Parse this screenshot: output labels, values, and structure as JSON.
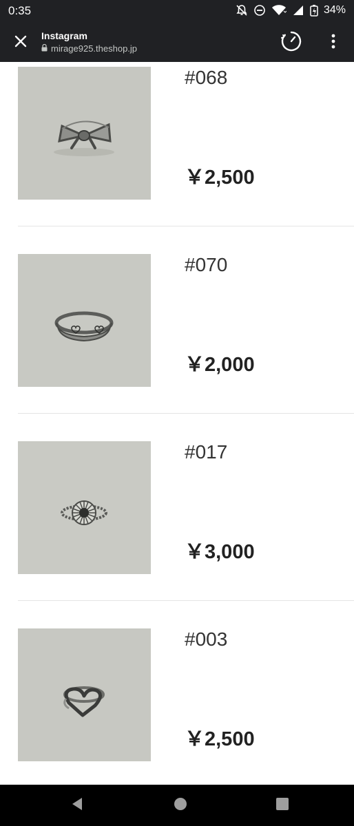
{
  "status_bar": {
    "time": "0:35",
    "battery": "34%",
    "icons": [
      "notifications-off-icon",
      "do-not-disturb-icon",
      "wifi-icon",
      "signal-icon",
      "battery-charging-icon"
    ]
  },
  "toolbar": {
    "title": "Instagram",
    "url": "mirage925.theshop.jp",
    "icons": [
      "close-icon",
      "lock-icon",
      "speed-gauge-icon",
      "more-vert-icon"
    ]
  },
  "products": [
    {
      "code": "#068",
      "price": "￥2,500",
      "image": "bow-ring"
    },
    {
      "code": "#070",
      "price": "￥2,000",
      "image": "heart-engraved-band-ring"
    },
    {
      "code": "#017",
      "price": "￥3,000",
      "image": "daisy-ring"
    },
    {
      "code": "#003",
      "price": "￥2,500",
      "image": "open-heart-ring"
    }
  ],
  "nav_bar": {
    "icons": [
      "back-icon",
      "home-icon",
      "recents-icon"
    ]
  },
  "colors": {
    "system_bar": "#202124",
    "nav_bar": "#000000",
    "photo_background": "#c7c8c2",
    "text_dark": "#222222"
  }
}
